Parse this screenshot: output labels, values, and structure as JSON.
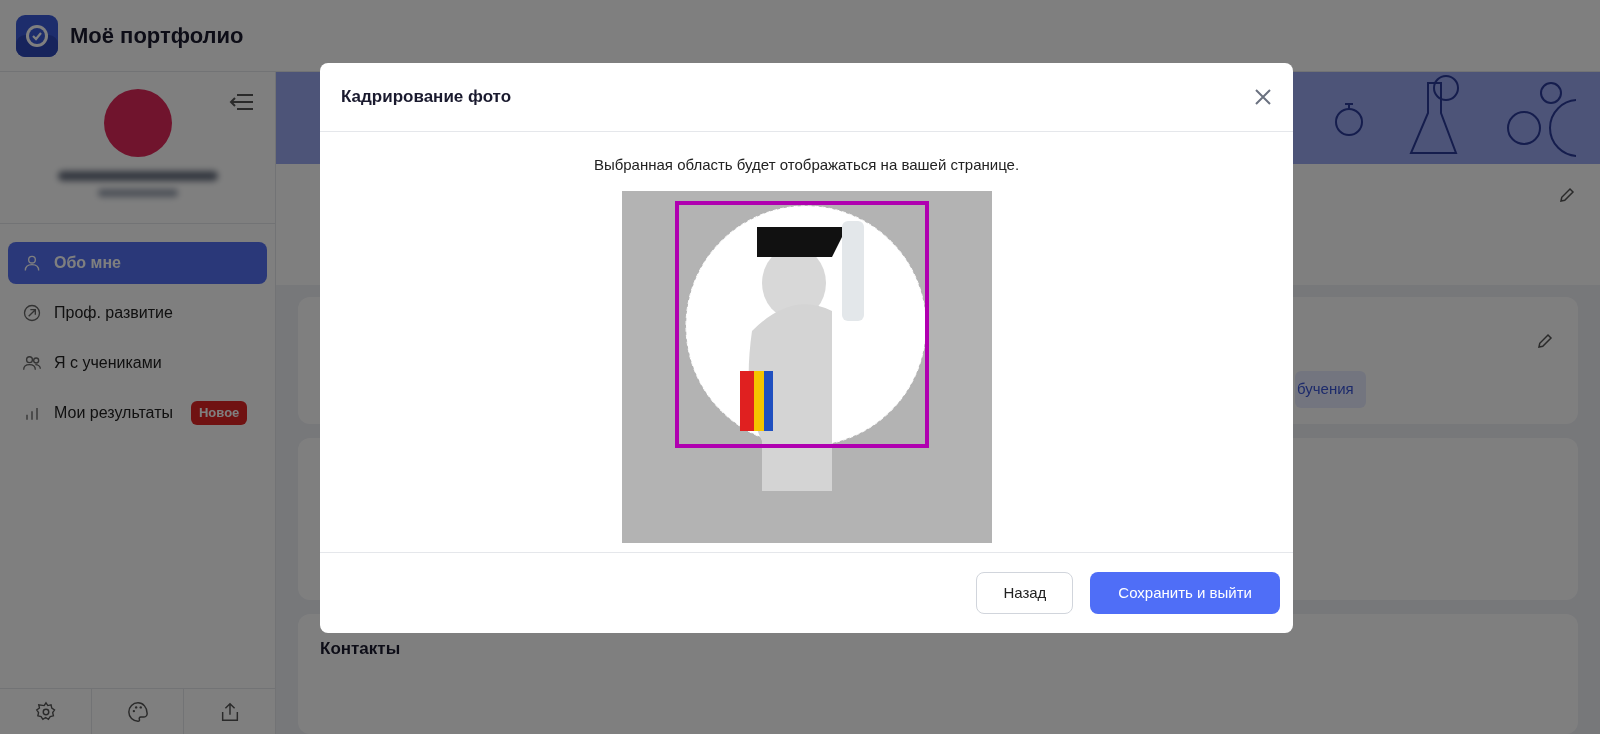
{
  "app": {
    "title": "Моё портфолио"
  },
  "sidebar": {
    "items": [
      {
        "label": "Обо мне",
        "selected": true
      },
      {
        "label": "Проф. развитие",
        "selected": false
      },
      {
        "label": "Я с учениками",
        "selected": false
      },
      {
        "label": "Мои результаты",
        "selected": false,
        "badge": "Новое"
      }
    ]
  },
  "page": {
    "chip": "бучения",
    "contacts_title": "Контакты"
  },
  "dialog": {
    "title": "Кадрирование фото",
    "description": "Выбранная область будет отображаться на вашей странице.",
    "buttons": [
      {
        "label": "Назад",
        "kind": "secondary"
      },
      {
        "label": "Сохранить и выйти",
        "kind": "primary"
      }
    ]
  }
}
